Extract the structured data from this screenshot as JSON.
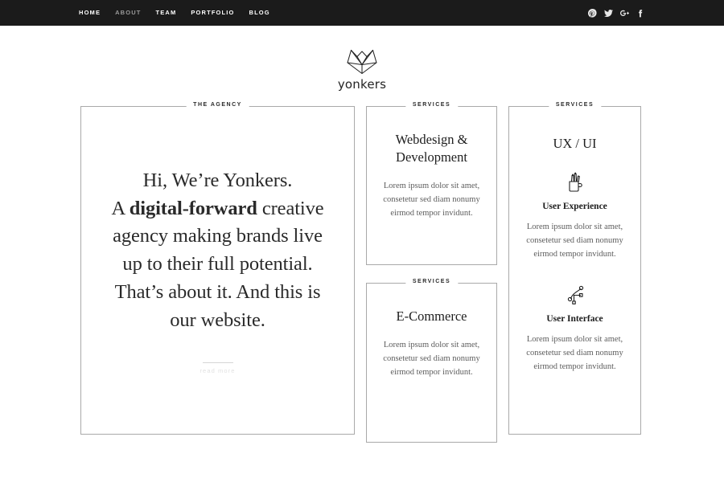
{
  "header": {
    "background_color": "#1b1b1b",
    "nav": [
      {
        "label": "HOME",
        "active": true
      },
      {
        "label": "ABOUT",
        "active": false
      },
      {
        "label": "TEAM",
        "active": false
      },
      {
        "label": "PORTFOLIO",
        "active": false
      },
      {
        "label": "BLOG",
        "active": false
      }
    ],
    "social": [
      {
        "name": "pinterest-icon"
      },
      {
        "name": "twitter-icon"
      },
      {
        "name": "google-plus-icon"
      },
      {
        "name": "facebook-icon"
      }
    ]
  },
  "logo": {
    "icon_name": "yonkers-fox-mark-icon",
    "wordmark": "yonkers"
  },
  "agency": {
    "label": "THE AGENCY",
    "headline_line1": "Hi, We’re Yonkers.",
    "headline_line2_a": "A ",
    "headline_line2_bold": "digital-forward",
    "headline_line2_b": " creative",
    "headline_line3": "agency making brands live",
    "headline_line4": "up to their full potential.",
    "headline_line5": "That’s about it. And this is",
    "headline_line6": "our website.",
    "read_more": "read more"
  },
  "services": [
    {
      "label": "SERVICES",
      "title_line1": "Webdesign &",
      "title_line2": "Development",
      "body": "Lorem ipsum dolor sit amet, consetetur sed diam nonumy eirmod tempor invidunt."
    },
    {
      "label": "SERVICES",
      "title_line1": "E-Commerce",
      "title_line2": "",
      "body": "Lorem ipsum dolor sit amet, consetetur sed diam nonumy eirmod tempor invidunt."
    }
  ],
  "uxui": {
    "label": "SERVICES",
    "title": "UX / UI",
    "features": [
      {
        "icon_name": "pencil-cup-icon",
        "heading": "User Experience",
        "body": "Lorem ipsum dolor sit amet, consetetur sed diam nonumy eirmod tempor invidunt."
      },
      {
        "icon_name": "bezier-pen-path-icon",
        "heading": "User Interface",
        "body": "Lorem ipsum dolor sit amet, consetetur sed diam nonumy eirmod tempor invidunt."
      }
    ]
  },
  "colors": {
    "header_bg": "#1b1b1b",
    "card_border": "#a9a9a9",
    "text_dark": "#1e1e1e",
    "text_body": "#5d5d5d",
    "read_more": "#e2e2e2"
  }
}
